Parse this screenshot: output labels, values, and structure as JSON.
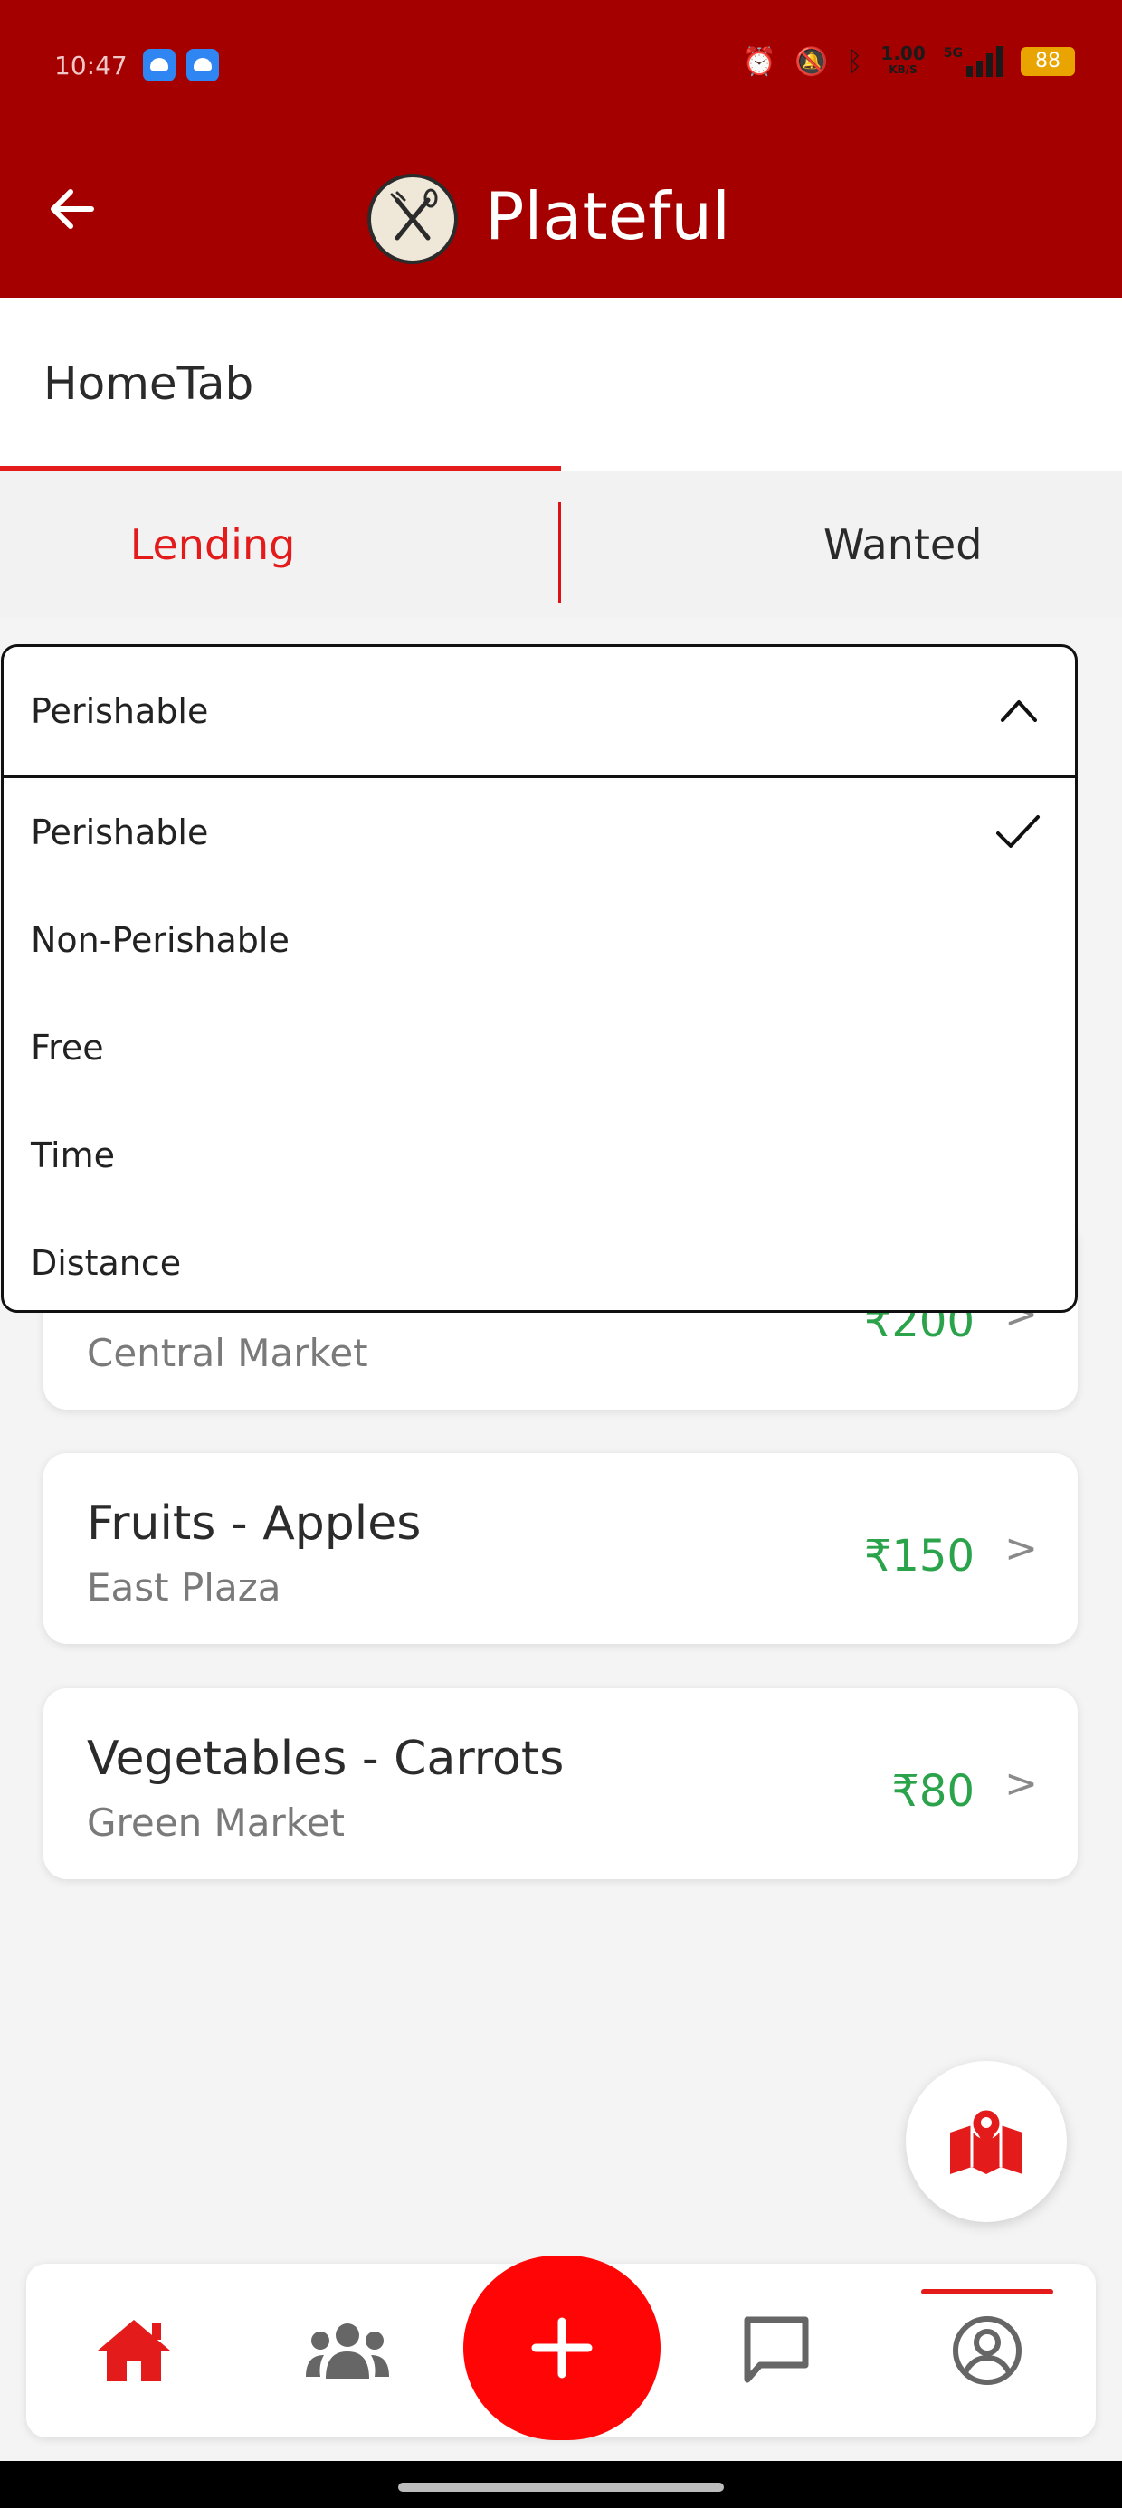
{
  "status_bar": {
    "time": "10:47",
    "net_speed": "1.00",
    "net_unit": "KB/S",
    "network": "5G",
    "battery": "88"
  },
  "header": {
    "app_name": "Plateful",
    "section_title": "HomeTab"
  },
  "tabs": [
    {
      "label": "Lending",
      "active": true
    },
    {
      "label": "Wanted",
      "active": false
    }
  ],
  "filter": {
    "selected": "Perishable",
    "options": [
      "Perishable",
      "Non-Perishable",
      "Free",
      "Time",
      "Distance"
    ]
  },
  "listings": [
    {
      "title": "",
      "place": "Central Market",
      "price": "₹200"
    },
    {
      "title": "Fruits - Apples",
      "place": "East Plaza",
      "price": "₹150"
    },
    {
      "title": "Vegetables - Carrots",
      "place": "Green Market",
      "price": "₹80"
    }
  ],
  "listing_arrow": ">",
  "colors": {
    "brand": "#a50000",
    "accent": "#e31b1b",
    "price": "#2aa34a",
    "add_button": "#ff0505"
  },
  "nav": {
    "items": [
      {
        "name": "home-icon",
        "active": true
      },
      {
        "name": "community-icon",
        "active": false
      },
      {
        "name": "add-icon",
        "active": false
      },
      {
        "name": "chat-icon",
        "active": false
      },
      {
        "name": "profile-icon",
        "active": false
      }
    ]
  }
}
